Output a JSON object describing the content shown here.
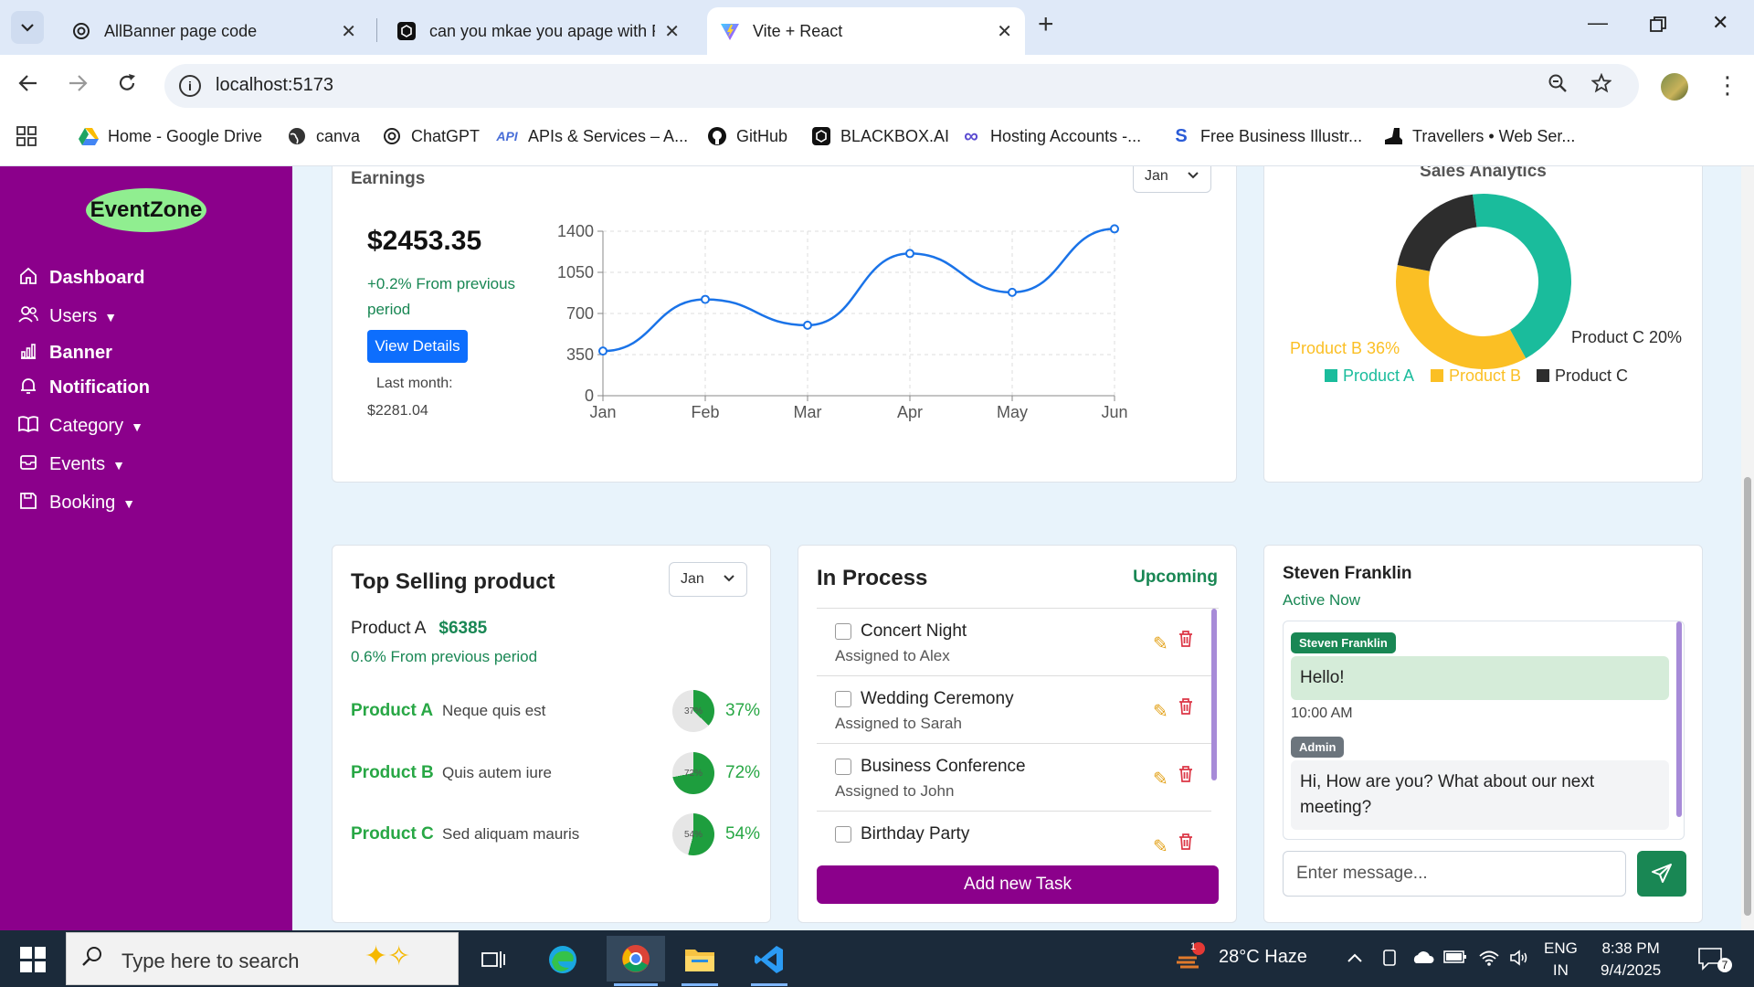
{
  "browser": {
    "tabs": [
      {
        "title": "AllBanner page code",
        "icon": "chatgpt-icon"
      },
      {
        "title": "can you mkae you apage with R",
        "icon": "blackbox-icon"
      },
      {
        "title": "Vite + React",
        "icon": "vite-icon"
      }
    ],
    "url": "localhost:5173",
    "bookmarks": [
      {
        "label": "Home - Google Drive",
        "icon": "google-drive-icon"
      },
      {
        "label": "canva",
        "icon": "globe-icon"
      },
      {
        "label": "ChatGPT",
        "icon": "chatgpt-icon"
      },
      {
        "label": "APIs & Services – A...",
        "icon": "api-icon",
        "icon_text": "API"
      },
      {
        "label": "GitHub",
        "icon": "github-icon"
      },
      {
        "label": "BLACKBOX.AI",
        "icon": "blackbox-icon"
      },
      {
        "label": "Hosting Accounts -...",
        "icon": "infinity-icon"
      },
      {
        "label": "Free Business Illustr...",
        "icon": "s-icon",
        "icon_text": "S"
      },
      {
        "label": "Travellers • Web Ser...",
        "icon": "boot-icon"
      }
    ]
  },
  "sidebar": {
    "logo": "EventZone",
    "items": [
      {
        "label": "Dashboard",
        "icon": "home-icon",
        "dropdown": false,
        "bold": true
      },
      {
        "label": "Users",
        "icon": "users-icon",
        "dropdown": true,
        "bold": false
      },
      {
        "label": "Banner",
        "icon": "bar-chart-icon",
        "dropdown": false,
        "bold": true
      },
      {
        "label": "Notification",
        "icon": "bell-icon",
        "dropdown": false,
        "bold": true
      },
      {
        "label": "Category",
        "icon": "book-icon",
        "dropdown": true,
        "bold": false
      },
      {
        "label": "Events",
        "icon": "inbox-icon",
        "dropdown": true,
        "bold": false
      },
      {
        "label": "Booking",
        "icon": "save-icon",
        "dropdown": true,
        "bold": false
      }
    ]
  },
  "earnings": {
    "title": "Earnings",
    "month_select": "Jan",
    "amount": "$2453.35",
    "change": "+0.2% From previous period",
    "button": "View Details",
    "last_month_label": "Last month:",
    "last_month_value": "$2281.04"
  },
  "sales": {
    "title": "Sales Analytics"
  },
  "chart_data": [
    {
      "type": "line",
      "categories": [
        "Jan",
        "Feb",
        "Mar",
        "Apr",
        "May",
        "Jun"
      ],
      "series": [
        {
          "values": [
            380,
            820,
            600,
            1210,
            880,
            1420
          ]
        }
      ],
      "yticks": [
        0,
        350,
        700,
        1050,
        1400
      ],
      "ylim": [
        0,
        1400
      ],
      "grid": true,
      "color": "#1a73e8"
    },
    {
      "type": "pie",
      "title": "Sales Analytics",
      "labels": [
        "Product A",
        "Product B",
        "Product C"
      ],
      "values": [
        44,
        36,
        20
      ],
      "colors": [
        "#1abc9c",
        "#fbbf24",
        "#2d2d2d"
      ],
      "slice_labels": [
        "Product B 36%",
        "Product C 20%"
      ],
      "legend": "bottom"
    }
  ],
  "top_selling": {
    "title": "Top Selling product",
    "month_select": "Jan",
    "product_label": "Product A",
    "product_value": "$6385",
    "change": "0.6% From previous period",
    "rows": [
      {
        "name": "Product A",
        "desc": "Neque quis est",
        "pct_text": "37%",
        "pct": 37
      },
      {
        "name": "Product B",
        "desc": "Quis autem iure",
        "pct_text": "72%",
        "pct": 72
      },
      {
        "name": "Product C",
        "desc": "Sed aliquam mauris",
        "pct_text": "54%",
        "pct": 54
      }
    ]
  },
  "in_process": {
    "title": "In Process",
    "upcoming": "Upcoming",
    "tasks": [
      {
        "name": "Concert Night",
        "assigned": "Assigned to Alex"
      },
      {
        "name": "Wedding Ceremony",
        "assigned": "Assigned to Sarah"
      },
      {
        "name": "Business Conference",
        "assigned": "Assigned to John"
      },
      {
        "name": "Birthday Party",
        "assigned": ""
      }
    ],
    "add_button": "Add new Task"
  },
  "chat": {
    "name": "Steven Franklin",
    "status": "Active Now",
    "messages": [
      {
        "sender": "Steven Franklin",
        "text": "Hello!",
        "time": "10:00 AM"
      },
      {
        "sender": "Admin",
        "text": "Hi, How are you? What about our next meeting?"
      }
    ],
    "input_placeholder": "Enter message..."
  },
  "taskbar": {
    "search_placeholder": "Type here to search",
    "weather": "28°C  Haze",
    "weather_badge": "1",
    "lang_top": "ENG",
    "lang_bottom": "IN",
    "time": "8:38 PM",
    "date": "9/4/2025",
    "notifications": "7"
  }
}
